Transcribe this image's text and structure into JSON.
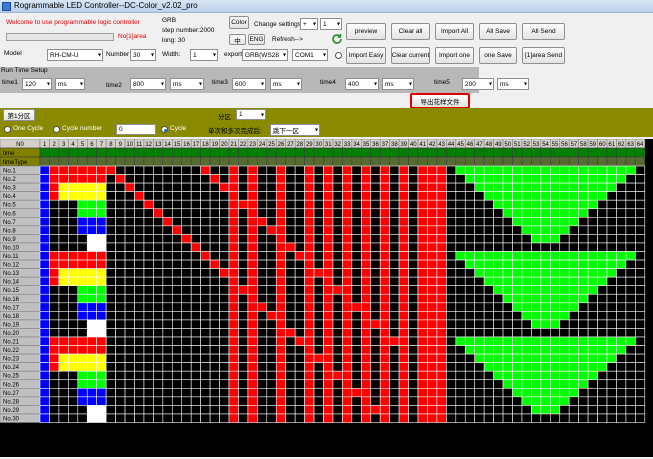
{
  "window": {
    "title": "Rogrammable LED Controller--DC-Color_v2.02_pro"
  },
  "top": {
    "welcome": "Welcome to use programmable logic controller",
    "area_status": "No[1]area",
    "color_order": "GRB",
    "step_number": "step number:2000",
    "long": "long: 30",
    "color_btn": "Color",
    "lang_cn": "中",
    "lang_en": "ENG",
    "change_settings": "Change settings",
    "change_op": "+",
    "change_val": "1",
    "refresh": "Refresh-->",
    "model_label": "Model",
    "model_value": "RH-CM-U",
    "number_label": "Number",
    "number_value": "30",
    "width_label": "Width:",
    "width_value": "1",
    "export_label": "export",
    "export_value": "GRB(WS28",
    "port_value": "COM1",
    "buttons": {
      "preview": "preview",
      "clear_all": "Clear all",
      "import_all": "Import All",
      "all_save": "All Save",
      "all_send": "All Send",
      "import_easy": "Import Easy",
      "clear_current": "Clear current",
      "import_one": "Import one",
      "one_save": "one Save",
      "area_send": "[1]area Send"
    }
  },
  "runtime": {
    "legend": "Run Time Setup",
    "times": [
      {
        "label": "time1",
        "value": "120",
        "unit": "ms"
      },
      {
        "label": "time2",
        "value": "800",
        "unit": "ms"
      },
      {
        "label": "time3",
        "value": "600",
        "unit": "ms"
      },
      {
        "label": "time4",
        "value": "400",
        "unit": "ms"
      },
      {
        "label": "time5",
        "value": "200",
        "unit": "ms"
      }
    ],
    "export_pattern": "导出花样文件"
  },
  "partition": {
    "tab": "第1分区",
    "label": "分区:",
    "value": "1"
  },
  "cycle": {
    "one_cycle": "One Cycle",
    "cycle_number": "Cycle number",
    "cycle_number_value": "0",
    "cycle": "Cycle",
    "after_label": "单次和多次完成后:",
    "after_value": "跳下一区"
  },
  "grid": {
    "corner": "N0",
    "row2_label": "time",
    "row3_label": "timeType",
    "columns": [
      "1",
      "2",
      "3",
      "4",
      "5",
      "6",
      "7",
      "8",
      "9",
      "10",
      "11",
      "12",
      "13",
      "14",
      "15",
      "16",
      "17",
      "18",
      "19",
      "20",
      "21",
      "22",
      "23",
      "24",
      "25",
      "26",
      "27",
      "28",
      "29",
      "30",
      "31",
      "32",
      "33",
      "34",
      "35",
      "36",
      "37",
      "38",
      "39",
      "40",
      "41",
      "42",
      "43",
      "44",
      "45",
      "46",
      "47",
      "48",
      "49",
      "50",
      "51",
      "52",
      "53",
      "54",
      "55",
      "56",
      "57",
      "58",
      "59",
      "60",
      "61",
      "62",
      "63",
      "64"
    ],
    "rows": [
      "No.1",
      "No.2",
      "No.3",
      "No.4",
      "No.5",
      "No.6",
      "No.7",
      "No.8",
      "No.9",
      "No.10",
      "No.11",
      "No.12",
      "No.13",
      "No.14",
      "No.15",
      "No.16",
      "No.17",
      "No.18",
      "No.19",
      "No.20",
      "No.21",
      "No.22",
      "No.23",
      "No.24",
      "No.25",
      "No.26",
      "No.27",
      "No.28",
      "No.29",
      "No.30"
    ],
    "colors": {
      "red": "#ff0000",
      "yellow": "#ffff00",
      "green": "#00ff00",
      "blue": "#0000ff",
      "white": "#ffffff",
      "black": "#000000",
      "header": "#d4d0c8",
      "label_bg": "#c0c0c0"
    }
  }
}
